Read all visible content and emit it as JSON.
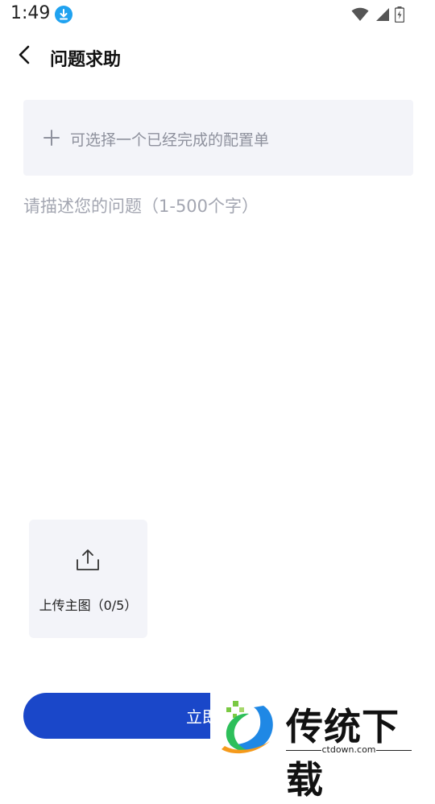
{
  "status_bar": {
    "time": "1:49",
    "icons": [
      "download-icon",
      "wifi-icon",
      "signal-icon",
      "battery-icon"
    ]
  },
  "header": {
    "back_icon": "chevron-left-icon",
    "title": "问题求助"
  },
  "config_selector": {
    "icon": "plus-icon",
    "label": "可选择一个已经完成的配置单"
  },
  "description": {
    "placeholder": "请描述您的问题（1-500个字）",
    "value": ""
  },
  "upload": {
    "icon": "upload-icon",
    "label": "上传主图（0/5）",
    "count": 0,
    "max": 5
  },
  "submit": {
    "label": "立即提交"
  },
  "watermark": {
    "text": "传统下载",
    "url": "ctdown.com"
  },
  "colors": {
    "primary": "#1a47c9",
    "panel_bg": "#f3f4f9",
    "placeholder": "#a3a6b1",
    "download_badge": "#1fa2f0"
  }
}
